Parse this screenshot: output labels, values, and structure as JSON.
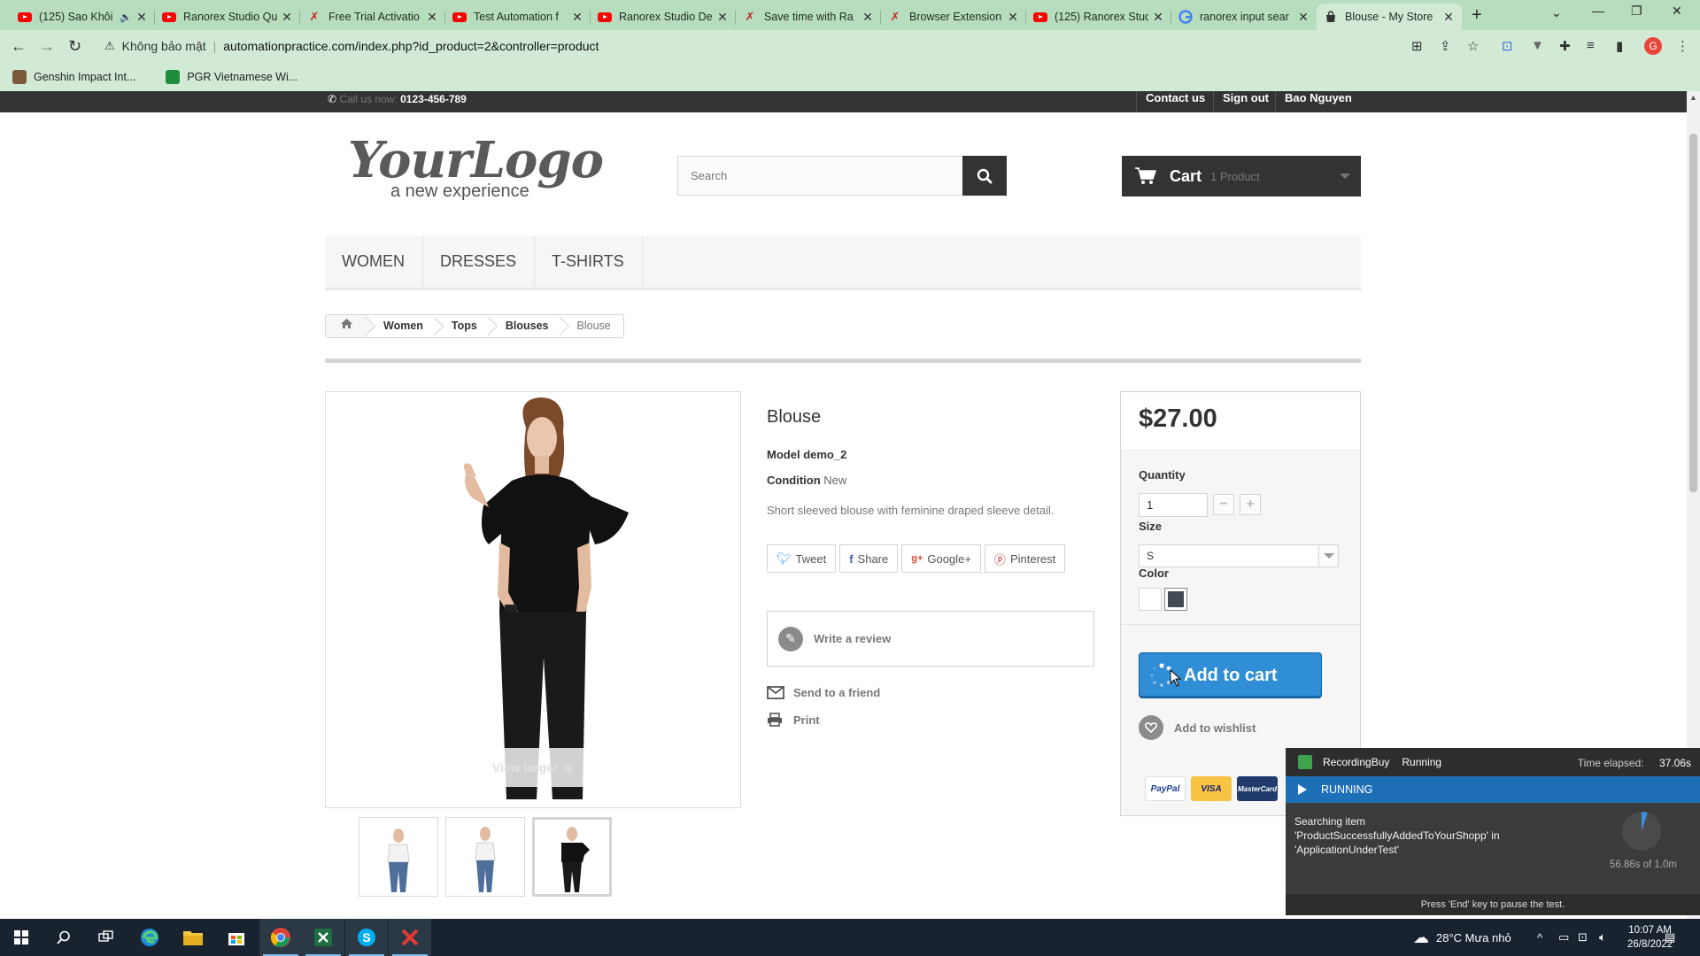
{
  "browser": {
    "tabs": [
      {
        "title": "(125) Sao Khôi",
        "icon": "youtube-icon"
      },
      {
        "title": "Ranorex Studio Qu",
        "icon": "youtube-icon"
      },
      {
        "title": "Free Trial Activatio",
        "icon": "ranorex-icon"
      },
      {
        "title": "Test Automation f",
        "icon": "youtube-icon"
      },
      {
        "title": "Ranorex Studio De",
        "icon": "youtube-icon"
      },
      {
        "title": "Save time with Ra",
        "icon": "ranorex-icon"
      },
      {
        "title": "Browser Extension",
        "icon": "ranorex-icon"
      },
      {
        "title": "(125) Ranorex Stud",
        "icon": "youtube-icon"
      },
      {
        "title": "ranorex input sear",
        "icon": "google-icon"
      },
      {
        "title": "Blouse - My Store",
        "icon": "store-icon",
        "active": true
      }
    ],
    "security_label": "Không bảo mật",
    "url": "automationpractice.com/index.php?id_product=2&controller=product",
    "bookmarks": [
      {
        "label": "Genshin Impact Int..."
      },
      {
        "label": "PGR Vietnamese Wi..."
      }
    ]
  },
  "store": {
    "call_label": "Call us now:",
    "phone": "0123-456-789",
    "top_links": [
      "Contact us",
      "Sign out",
      "Bao Nguyen"
    ],
    "logo": {
      "title": "YourLogo",
      "tagline": "a new experience"
    },
    "search_placeholder": "Search",
    "cart": {
      "label": "Cart",
      "count": "1 Product"
    },
    "menu": [
      "WOMEN",
      "DRESSES",
      "T-SHIRTS"
    ],
    "breadcrumb": [
      "Women",
      "Tops",
      "Blouses",
      "Blouse"
    ],
    "view_larger": "View larger"
  },
  "product": {
    "name": "Blouse",
    "model_label": "Model",
    "model": "demo_2",
    "condition_label": "Condition",
    "condition": "New",
    "description": "Short sleeved blouse with feminine draped sleeve detail.",
    "social": [
      "Tweet",
      "Share",
      "Google+",
      "Pinterest"
    ],
    "write_review": "Write a review",
    "send_friend": "Send to a friend",
    "print": "Print",
    "price": "$27.00",
    "quantity_label": "Quantity",
    "quantity": "1",
    "size_label": "Size",
    "size": "S",
    "color_label": "Color",
    "colors": [
      "#ffffff",
      "#434a54"
    ],
    "add_to_cart": "Add to cart",
    "add_wishlist": "Add to wishlist",
    "payments": [
      "PayPal",
      "VISA",
      "MasterCard"
    ]
  },
  "ranorex": {
    "recording": "RecordingBuy",
    "state": "Running",
    "elapsed_label": "Time elapsed:",
    "elapsed": "37.06s",
    "status": "RUNNING",
    "message": "Searching item 'ProductSuccessfullyAddedToYourShopp' in 'ApplicationUnderTest'",
    "timeout": "56.86s of 1.0m",
    "timeout_fraction": 0.05,
    "footer": "Press 'End' key to pause the test."
  },
  "taskbar": {
    "weather": "28°C  Mưa nhỏ",
    "time": "10:07 AM",
    "date": "26/8/2022"
  }
}
